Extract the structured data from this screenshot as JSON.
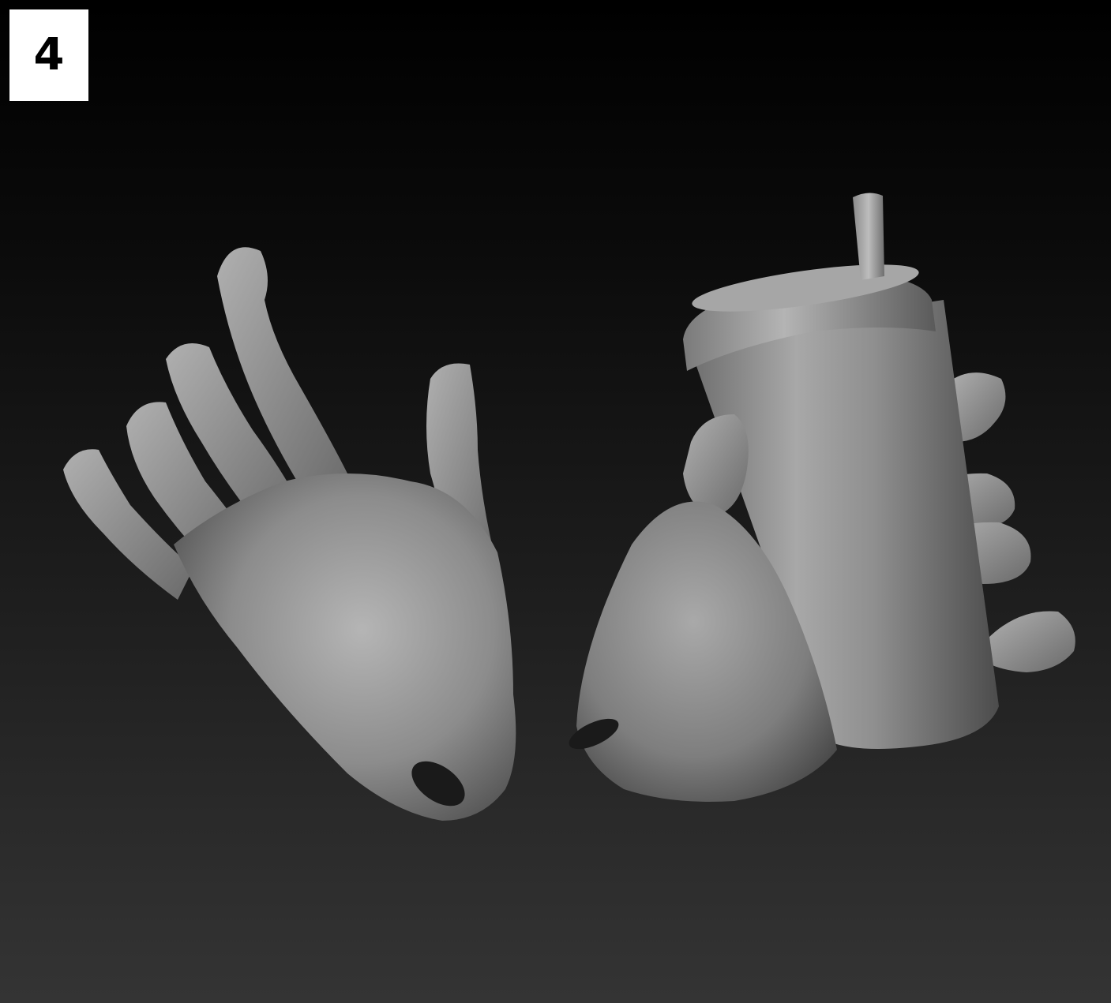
{
  "badge": {
    "number": "4"
  },
  "colors": {
    "background_top": "#000000",
    "background_bottom": "#343434",
    "model_base": "#8e8e8e",
    "model_highlight": "#c4c4c4",
    "model_shadow": "#3a3a3a"
  },
  "icons": {
    "left_hand": "open-hand-render",
    "right_hand": "hand-holding-cup-render"
  }
}
